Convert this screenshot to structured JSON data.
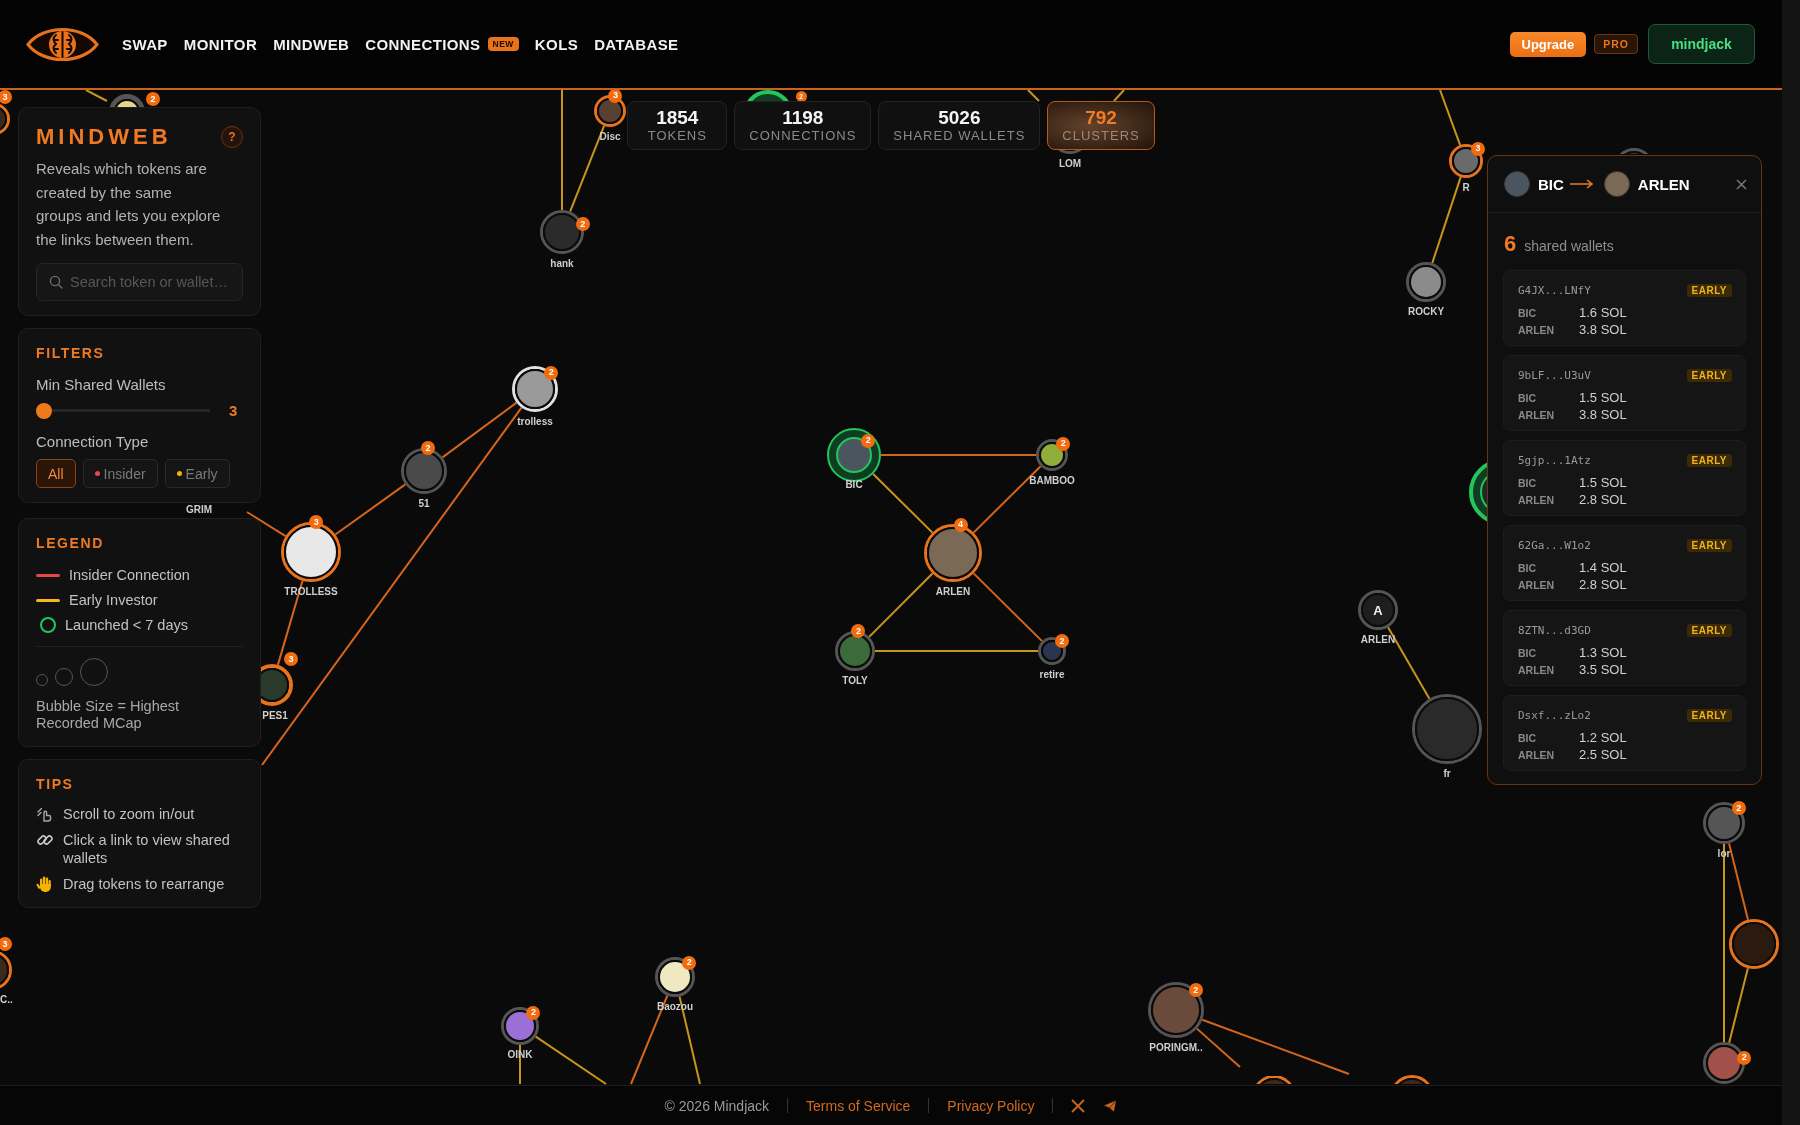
{
  "header": {
    "nav": [
      {
        "label": "SWAP"
      },
      {
        "label": "MONITOR"
      },
      {
        "label": "MINDWEB"
      },
      {
        "label": "CONNECTIONS",
        "badge": "NEW"
      },
      {
        "label": "KOLS"
      },
      {
        "label": "DATABASE"
      }
    ],
    "upgrade": "Upgrade",
    "plan": "PRO",
    "account": "mindjack"
  },
  "stats": [
    {
      "value": "1854",
      "label": "TOKENS",
      "highlighted": false
    },
    {
      "value": "1198",
      "label": "CONNECTIONS",
      "highlighted": false
    },
    {
      "value": "5026",
      "label": "SHARED WALLETS",
      "highlighted": false
    },
    {
      "value": "792",
      "label": "CLUSTERS",
      "highlighted": true
    }
  ],
  "about": {
    "title": "MINDWEB",
    "help": "?",
    "text": "Reveals which tokens are created by the same groups and lets you explore the links between them.",
    "search": {
      "placeholder": "Search token or wallet…"
    }
  },
  "filters": {
    "title": "FILTERS",
    "min_wallets": {
      "label": "Min Shared Wallets",
      "level": 0,
      "reading": "3"
    },
    "connection_type": {
      "label": "Connection Type",
      "options": [
        {
          "label": "All",
          "selected": true
        },
        {
          "label": "Insider",
          "selected": false,
          "color": "#e5484d"
        },
        {
          "label": "Early",
          "selected": false,
          "color": "#f5b400"
        }
      ]
    }
  },
  "legend": {
    "title": "LEGEND",
    "items": [
      {
        "kind": "line",
        "label": "Insider Connection",
        "color": "#e5484d"
      },
      {
        "kind": "line",
        "label": "Early Investor",
        "color": "#f2b81c"
      },
      {
        "kind": "ring",
        "label": "Launched < 7 days",
        "color": "#22c55e"
      }
    ],
    "size_note": "Bubble Size = Highest Recorded MCap"
  },
  "tips": {
    "title": "TIPS",
    "items": [
      {
        "kind": "scroll",
        "text": "Scroll to zoom in/out"
      },
      {
        "kind": "link",
        "text": "Click a link to view shared wallets"
      },
      {
        "kind": "drag",
        "text": "Drag tokens to rearrange"
      }
    ]
  },
  "graph": {
    "nodes": [
      {
        "kind": "token",
        "badge": "3",
        "color": "#e8731c",
        "recent": false
      },
      {
        "kind": "token",
        "badge": "2",
        "color": "#555555",
        "recent": false
      },
      {
        "kind": "token",
        "label": "Disc",
        "badge": "3",
        "color": "#e8731c",
        "recent": false
      },
      {
        "kind": "token",
        "badge": "2",
        "color": "#22c55e",
        "recent": true
      },
      {
        "kind": "token",
        "label": "hank",
        "badge": "2",
        "color": "#555555",
        "recent": false
      },
      {
        "kind": "token",
        "label": "LOM",
        "color": "#555555",
        "recent": false
      },
      {
        "kind": "token",
        "label": "R",
        "badge": "3",
        "color": "#e8731c",
        "recent": false
      },
      {
        "kind": "token",
        "color": "#555555",
        "recent": false
      },
      {
        "kind": "token",
        "label": "ROCKY",
        "color": "#555555",
        "recent": false
      },
      {
        "kind": "token",
        "label": "trolless",
        "badge": "2",
        "color": "#e0e0e0",
        "recent": false
      },
      {
        "kind": "token",
        "label": "51",
        "badge": "2",
        "color": "#555555",
        "recent": false
      },
      {
        "kind": "token",
        "label": "TROLLESS",
        "badge": "3",
        "color": "#e8731c",
        "recent": false
      },
      {
        "kind": "label",
        "label": "GRIM"
      },
      {
        "kind": "token",
        "label": "PES1",
        "badge": "3",
        "color": "#e8731c",
        "recent": false
      },
      {
        "kind": "token",
        "label": "BIC",
        "badge": "2",
        "color": "#22c55e",
        "recent": true
      },
      {
        "kind": "token",
        "label": "BAMBOO",
        "badge": "2",
        "color": "#555555",
        "recent": false
      },
      {
        "kind": "token",
        "label": "ARLEN",
        "badge": "4",
        "color": "#e8731c",
        "recent": false
      },
      {
        "kind": "token",
        "label": "TOLY",
        "badge": "2",
        "color": "#555555",
        "recent": false
      },
      {
        "kind": "token",
        "label": "retire",
        "badge": "2",
        "color": "#555555",
        "recent": false
      },
      {
        "kind": "token",
        "initial": "A",
        "label": "ARLEN",
        "color": "#555555",
        "recent": false
      },
      {
        "kind": "token",
        "color": "#22c55e",
        "recent": true
      },
      {
        "kind": "token",
        "label": "fr",
        "color": "#555555",
        "recent": false
      },
      {
        "kind": "token",
        "label": "lor",
        "badge": "2",
        "color": "#555555",
        "recent": false
      },
      {
        "kind": "token",
        "color": "#e8731c",
        "recent": false
      },
      {
        "kind": "token",
        "badge": "2",
        "color": "#555555",
        "recent": false
      },
      {
        "kind": "token",
        "label": "C..",
        "badge": "3",
        "color": "#e8731c",
        "recent": false
      },
      {
        "kind": "token",
        "label": "OINK",
        "badge": "2",
        "color": "#555555",
        "recent": false
      },
      {
        "kind": "token",
        "label": "Baozou",
        "badge": "2",
        "color": "#555555",
        "recent": false
      },
      {
        "kind": "token",
        "label": "PORINGM..",
        "badge": "2",
        "color": "#555555",
        "recent": false
      },
      {
        "kind": "token",
        "color": "#e8731c",
        "recent": false
      },
      {
        "kind": "token",
        "color": "#e8731c",
        "recent": false
      }
    ],
    "links": [
      {
        "color": "#c8951c"
      },
      {
        "color": "#c8951c"
      },
      {
        "color": "#c8951c"
      },
      {
        "color": "#c8951c"
      },
      {
        "color": "#c8951c"
      },
      {
        "color": "#c8951c"
      },
      {
        "color": "#c8951c"
      },
      {
        "color": "#d4661c"
      },
      {
        "color": "#d4661c"
      },
      {
        "color": "#d4661c"
      },
      {
        "color": "#d4661c"
      },
      {
        "color": "#d4661c"
      },
      {
        "color": "#d4661c"
      },
      {
        "color": "#c8951c"
      },
      {
        "color": "#d4661c"
      },
      {
        "color": "#c8951c"
      },
      {
        "color": "#d4661c"
      },
      {
        "color": "#c8951c"
      },
      {
        "color": "#c8951c"
      },
      {
        "color": "#c8951c"
      },
      {
        "color": "#d4661c"
      },
      {
        "color": "#c8951c"
      },
      {
        "color": "#c8951c"
      },
      {
        "color": "#c8951c"
      },
      {
        "color": "#d4661c"
      },
      {
        "color": "#c8951c"
      },
      {
        "color": "#d4661c"
      },
      {
        "color": "#d4661c"
      }
    ]
  },
  "detail": {
    "from": "BIC",
    "to": "ARLEN",
    "count": "6",
    "count_label": "shared wallets",
    "wallets": [
      {
        "address": "G4JX...LNfY",
        "tag": "EARLY",
        "amounts": [
          {
            "token": "BIC",
            "value": "1.6 SOL"
          },
          {
            "token": "ARLEN",
            "value": "3.8 SOL"
          }
        ]
      },
      {
        "address": "9bLF...U3uV",
        "tag": "EARLY",
        "amounts": [
          {
            "token": "BIC",
            "value": "1.5 SOL"
          },
          {
            "token": "ARLEN",
            "value": "3.8 SOL"
          }
        ]
      },
      {
        "address": "5gjp...1Atz",
        "tag": "EARLY",
        "amounts": [
          {
            "token": "BIC",
            "value": "1.5 SOL"
          },
          {
            "token": "ARLEN",
            "value": "2.8 SOL"
          }
        ]
      },
      {
        "address": "62Ga...W1o2",
        "tag": "EARLY",
        "amounts": [
          {
            "token": "BIC",
            "value": "1.4 SOL"
          },
          {
            "token": "ARLEN",
            "value": "2.8 SOL"
          }
        ]
      },
      {
        "address": "8ZTN...d3GD",
        "tag": "EARLY",
        "amounts": [
          {
            "token": "BIC",
            "value": "1.3 SOL"
          },
          {
            "token": "ARLEN",
            "value": "3.5 SOL"
          }
        ]
      },
      {
        "address": "Dsxf...zLo2",
        "tag": "EARLY",
        "amounts": [
          {
            "token": "BIC",
            "value": "1.2 SOL"
          },
          {
            "token": "ARLEN",
            "value": "2.5 SOL"
          }
        ]
      }
    ]
  },
  "footer": {
    "copyright": "© 2026 Mindjack",
    "links": [
      "Terms of Service",
      "Privacy Policy"
    ]
  }
}
